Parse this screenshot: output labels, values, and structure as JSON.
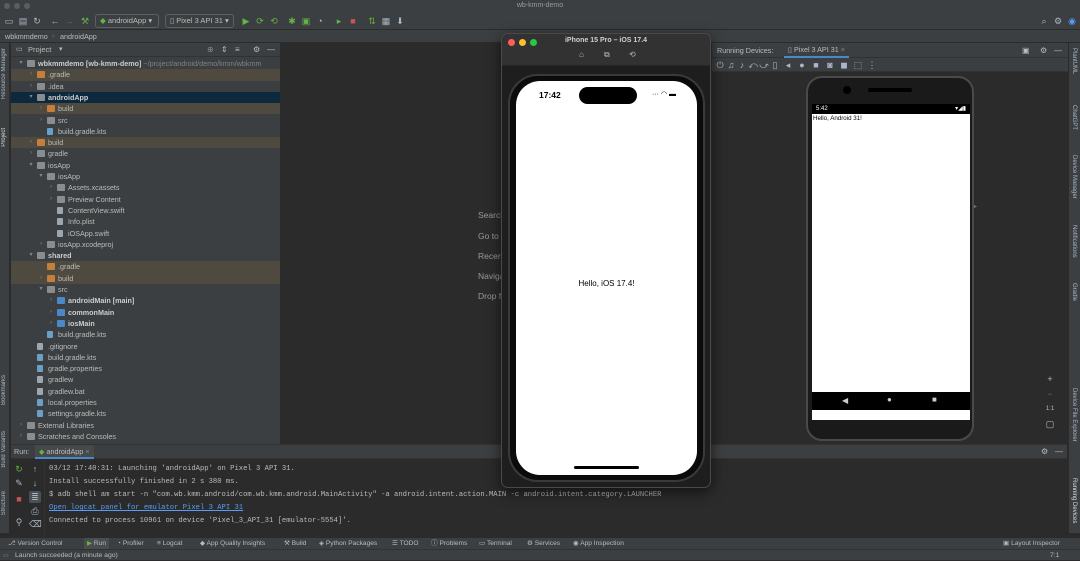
{
  "window": {
    "title": "wb-kmm-demo"
  },
  "toolbar": {
    "run_config": "androidApp",
    "device": "Pixel 3 API 31"
  },
  "nav": {
    "crumbs": [
      "wbkmmdemo",
      "androidApp"
    ]
  },
  "left_strip": {
    "top": [
      "Resource Manager",
      "Project"
    ],
    "bottom": [
      "Bookmarks",
      "Build Variants",
      "Structure"
    ]
  },
  "right_strip": {
    "items": [
      "PlantUML",
      "ChatGPT",
      "Device Manager",
      "Notifications",
      "Gradle",
      "Device File Explorer",
      "Running Devices"
    ]
  },
  "project": {
    "title": "Project",
    "tree": [
      {
        "label": "wbkmmdemo [wb-kmm-demo]",
        "suffix": " ~/project/android/demo/kmm/wbkmm",
        "depth": 0,
        "open": true,
        "icon": "module",
        "bold": true
      },
      {
        "label": ".gradle",
        "depth": 1,
        "open": false,
        "icon": "folder-orange",
        "hl": true
      },
      {
        "label": ".idea",
        "depth": 1,
        "open": false,
        "icon": "folder"
      },
      {
        "label": "androidApp",
        "depth": 1,
        "open": true,
        "icon": "module",
        "bold": true,
        "sel": true
      },
      {
        "label": "build",
        "depth": 2,
        "open": false,
        "icon": "folder-orange",
        "hl": true
      },
      {
        "label": "src",
        "depth": 2,
        "open": false,
        "icon": "folder"
      },
      {
        "label": "build.gradle.kts",
        "depth": 2,
        "icon": "gradle"
      },
      {
        "label": "build",
        "depth": 1,
        "open": false,
        "icon": "folder-orange",
        "hl": true
      },
      {
        "label": "gradle",
        "depth": 1,
        "open": false,
        "icon": "folder"
      },
      {
        "label": "iosApp",
        "depth": 1,
        "open": true,
        "icon": "folder"
      },
      {
        "label": "iosApp",
        "depth": 2,
        "open": true,
        "icon": "folder"
      },
      {
        "label": "Assets.xcassets",
        "depth": 3,
        "open": false,
        "icon": "folder"
      },
      {
        "label": "Preview Content",
        "depth": 3,
        "open": false,
        "icon": "folder"
      },
      {
        "label": "ContentView.swift",
        "depth": 3,
        "icon": "file"
      },
      {
        "label": "Info.plist",
        "depth": 3,
        "icon": "file"
      },
      {
        "label": "iOSApp.swift",
        "depth": 3,
        "icon": "file"
      },
      {
        "label": "iosApp.xcodeproj",
        "depth": 2,
        "open": false,
        "icon": "folder"
      },
      {
        "label": "shared",
        "depth": 1,
        "open": true,
        "icon": "module",
        "bold": true
      },
      {
        "label": ".gradle",
        "depth": 2,
        "icon": "folder-orange",
        "hl": true
      },
      {
        "label": "build",
        "depth": 2,
        "open": false,
        "icon": "folder-orange",
        "hl": true
      },
      {
        "label": "src",
        "depth": 2,
        "open": true,
        "icon": "folder"
      },
      {
        "label": "androidMain [main]",
        "depth": 3,
        "open": false,
        "icon": "folder-blue",
        "bold": true
      },
      {
        "label": "commonMain",
        "depth": 3,
        "open": false,
        "icon": "folder-blue",
        "bold": true
      },
      {
        "label": "iosMain",
        "depth": 3,
        "open": false,
        "icon": "folder-blue",
        "bold": true
      },
      {
        "label": "build.gradle.kts",
        "depth": 2,
        "icon": "gradle"
      },
      {
        "label": ".gitignore",
        "depth": 1,
        "icon": "file"
      },
      {
        "label": "build.gradle.kts",
        "depth": 1,
        "icon": "gradle"
      },
      {
        "label": "gradle.properties",
        "depth": 1,
        "icon": "gradle"
      },
      {
        "label": "gradlew",
        "depth": 1,
        "icon": "file"
      },
      {
        "label": "gradlew.bat",
        "depth": 1,
        "icon": "file"
      },
      {
        "label": "local.properties",
        "depth": 1,
        "icon": "gradle"
      },
      {
        "label": "settings.gradle.kts",
        "depth": 1,
        "icon": "gradle"
      },
      {
        "label": "External Libraries",
        "depth": 0,
        "open": false,
        "icon": "lib"
      },
      {
        "label": "Scratches and Consoles",
        "depth": 0,
        "open": false,
        "icon": "lib"
      }
    ]
  },
  "editor": {
    "hints": [
      "Search",
      "Go to",
      "Recent",
      "Naviga",
      "Drop fi"
    ]
  },
  "simulator": {
    "title": "iPhone 15 Pro – iOS 17.4",
    "time": "17:42",
    "text": "Hello, iOS 17.4!"
  },
  "running_devices": {
    "label": "Running Devices:",
    "tab": "Pixel 3 API 31",
    "time": "5:42",
    "text": "Hello, Android 31!",
    "zoom_ratio": "1:1"
  },
  "run": {
    "label": "Run:",
    "tab": "androidApp",
    "lines": [
      "03/12 17:40:31: Launching 'androidApp' on Pixel 3 API 31.",
      "Install successfully finished in 2 s 380 ms.",
      "$ adb shell am start -n \"com.wb.kmm.android/com.wb.kmm.android.MainActivity\" -a android.intent.action.MAIN -c android.intent.category.LAUNCHER",
      "Open logcat panel for emulator Pixel 3 API 31",
      "Connected to process 10961 on device 'Pixel_3_API_31 [emulator-5554]'."
    ]
  },
  "bottom_tabs": [
    "Version Control",
    "Run",
    "Profiler",
    "Logcat",
    "App Quality Insights",
    "Build",
    "Python Packages",
    "TODO",
    "Problems",
    "Terminal",
    "Services",
    "App Inspection"
  ],
  "bottom_right": "Layout Inspector",
  "status": {
    "text": "Launch succeeded (a minute ago)",
    "right": "7:1"
  }
}
